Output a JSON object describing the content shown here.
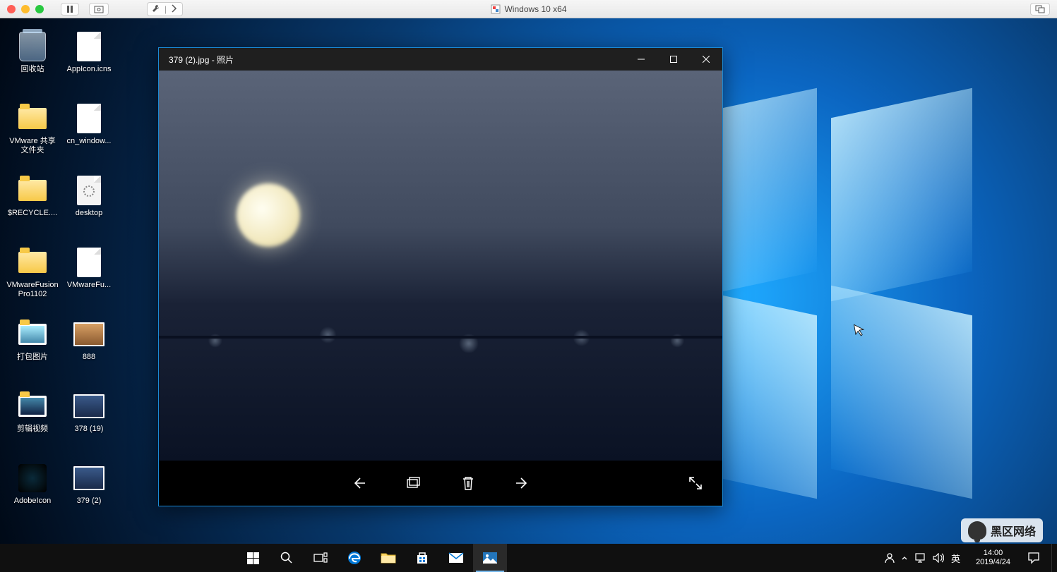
{
  "mac": {
    "title": "Windows 10 x64"
  },
  "desktop_icons": [
    {
      "label": "回收站",
      "type": "bin"
    },
    {
      "label": "AppIcon.icns",
      "type": "file"
    },
    {
      "label": "VMware 共享文件夹",
      "type": "folder"
    },
    {
      "label": "cn_window...",
      "type": "file"
    },
    {
      "label": "$RECYCLE....",
      "type": "folder"
    },
    {
      "label": "desktop",
      "type": "file"
    },
    {
      "label": "VMwareFusionPro1102",
      "type": "folder"
    },
    {
      "label": "VMwareFu...",
      "type": "file"
    },
    {
      "label": "打包图片",
      "type": "folder"
    },
    {
      "label": "888",
      "type": "thumb"
    },
    {
      "label": "剪辑视频",
      "type": "folder"
    },
    {
      "label": "378 (19)",
      "type": "thumb"
    },
    {
      "label": "AdobeIcon",
      "type": "file-dark"
    },
    {
      "label": "379 (2)",
      "type": "thumb"
    }
  ],
  "photos": {
    "title": "379 (2).jpg - 照片"
  },
  "taskbar": {
    "tray": {
      "ime": "英"
    },
    "clock": {
      "time": "14:00",
      "date": "2019/4/24"
    }
  },
  "watermark": "黑区网络"
}
